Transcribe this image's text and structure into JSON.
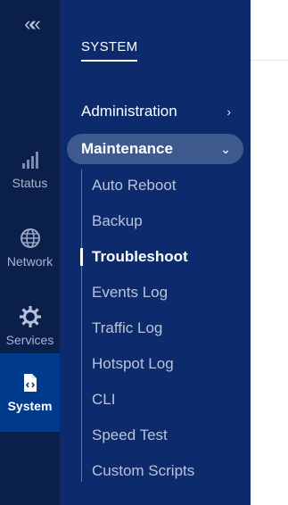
{
  "sidebar": {
    "collapse_glyph": "«",
    "items": [
      {
        "label": "Status",
        "icon": "signal-bars-icon"
      },
      {
        "label": "Network",
        "icon": "globe-icon"
      },
      {
        "label": "Services",
        "icon": "gear-icon"
      },
      {
        "label": "System",
        "icon": "system-file-icon",
        "active": true
      }
    ]
  },
  "panel": {
    "section_title": "SYSTEM",
    "menus": [
      {
        "label": "Administration",
        "chevron": "›"
      },
      {
        "label": "Maintenance",
        "chevron": "⌄",
        "expanded": true
      }
    ],
    "submenu": [
      {
        "label": "Auto Reboot"
      },
      {
        "label": "Backup"
      },
      {
        "label": "Troubleshoot",
        "active": true
      },
      {
        "label": "Events Log"
      },
      {
        "label": "Traffic Log"
      },
      {
        "label": "Hotspot Log"
      },
      {
        "label": "CLI"
      },
      {
        "label": "Speed Test"
      },
      {
        "label": "Custom Scripts"
      }
    ]
  },
  "colors": {
    "rail_bg": "#0a1f4a",
    "panel_bg": "#0d2a6c",
    "active_bg": "#003a8c",
    "expanded_pill": "#3e5a8f"
  }
}
